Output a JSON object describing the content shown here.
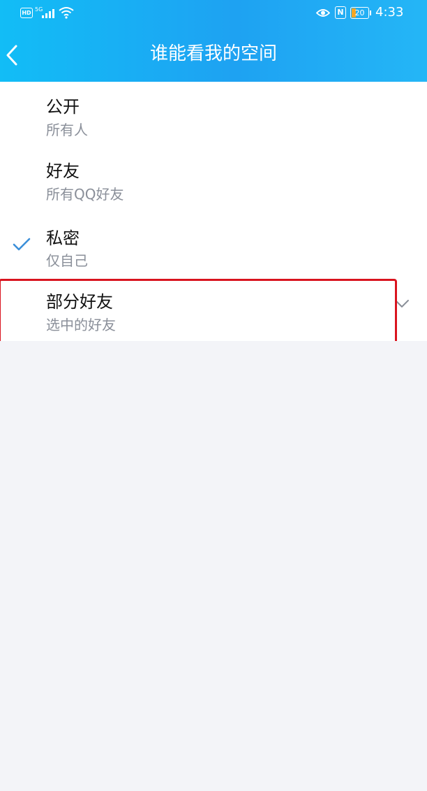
{
  "status_bar": {
    "hd_label": "HD",
    "network_label": "5G",
    "nfc_label": "N",
    "battery_level": "20",
    "time": "4:33"
  },
  "header": {
    "title": "谁能看我的空间",
    "back_icon": "chevron-left-icon"
  },
  "options": [
    {
      "title": "公开",
      "subtitle": "所有人",
      "selected": false
    },
    {
      "title": "好友",
      "subtitle": "所有QQ好友",
      "selected": false
    },
    {
      "title": "私密",
      "subtitle": "仅自己",
      "selected": true
    },
    {
      "title": "部分好友",
      "subtitle": "选中的好友",
      "selected": false,
      "expandable": true
    }
  ],
  "colors": {
    "header_gradient_start": "#12bdf6",
    "header_gradient_end": "#24b6f6",
    "check": "#3b8fd9",
    "highlight": "#d9141f",
    "background": "#f3f4f8"
  }
}
